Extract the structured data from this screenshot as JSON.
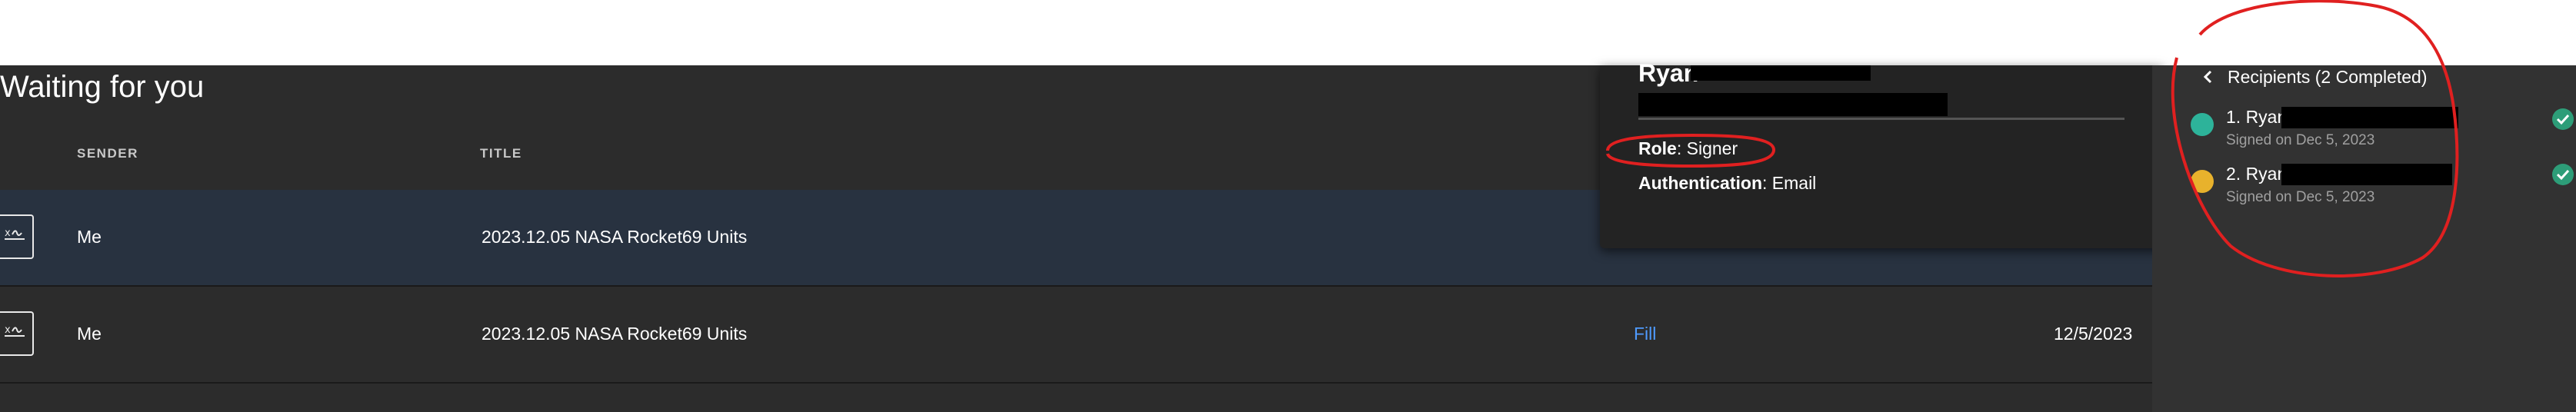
{
  "page": {
    "heading": "Waiting for you"
  },
  "table": {
    "headers": {
      "sender": "SENDER",
      "title": "TITLE"
    },
    "rows": [
      {
        "sender": "Me",
        "title": "2023.12.05 NASA Rocket69 Units",
        "action": "",
        "date": ""
      },
      {
        "sender": "Me",
        "title": "2023.12.05 NASA Rocket69 Units",
        "action": "Fill",
        "date": "12/5/2023"
      }
    ]
  },
  "popover": {
    "name": "Ryan",
    "role_label": "Role",
    "role_value": ": Signer",
    "auth_label": "Authentication",
    "auth_value": ": Email"
  },
  "recipients": {
    "header": "Recipients (2 Completed)",
    "items": [
      {
        "name": "1. Ryan",
        "status": "Signed on Dec 5, 2023",
        "avatar_color": "#2db39a"
      },
      {
        "name": "2. Ryan",
        "status": "Signed on Dec 5, 2023",
        "avatar_color": "#e8b22c"
      }
    ]
  },
  "colors": {
    "accent_link": "#4f9bff",
    "check_green": "#2d9d78",
    "annotation_red": "#e02020"
  },
  "icons": [
    "document-sign-icon",
    "chevron-left-icon",
    "checkmark-icon"
  ]
}
